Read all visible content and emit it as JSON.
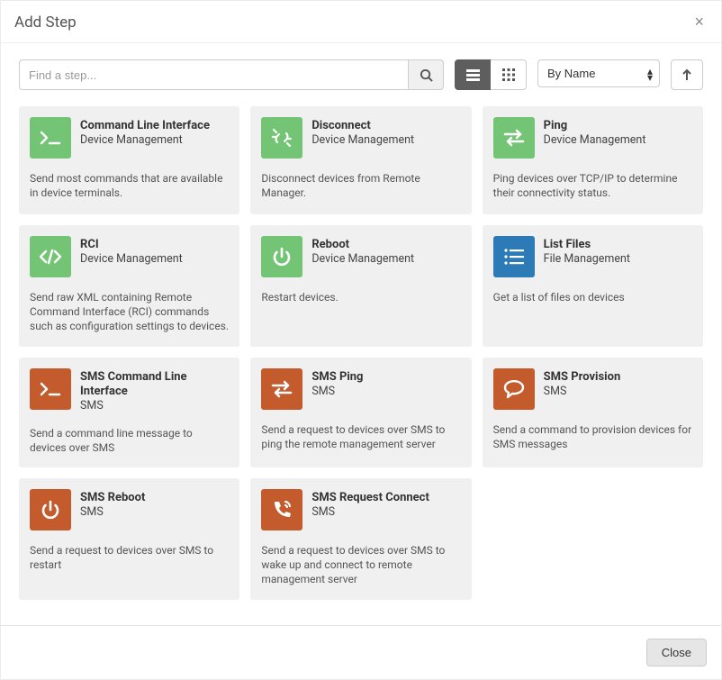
{
  "dialog": {
    "title": "Add Step",
    "close_label": "Close"
  },
  "search": {
    "placeholder": "Find a step..."
  },
  "sort": {
    "selected": "By Name"
  },
  "cards": [
    {
      "icon": "terminal-icon",
      "color": "green",
      "title": "Command Line Interface",
      "subtitle": "Device Management",
      "desc": "Send most commands that are available in device terminals."
    },
    {
      "icon": "disconnect-icon",
      "color": "green",
      "title": "Disconnect",
      "subtitle": "Device Management",
      "desc": "Disconnect devices from Remote Manager."
    },
    {
      "icon": "swap-icon",
      "color": "green",
      "title": "Ping",
      "subtitle": "Device Management",
      "desc": "Ping devices over TCP/IP to determine their connectivity status."
    },
    {
      "icon": "code-icon",
      "color": "green",
      "title": "RCI",
      "subtitle": "Device Management",
      "desc": "Send raw XML containing Remote Command Interface (RCI) commands such as configuration settings to devices."
    },
    {
      "icon": "power-icon",
      "color": "green",
      "title": "Reboot",
      "subtitle": "Device Management",
      "desc": "Restart devices."
    },
    {
      "icon": "list-icon",
      "color": "blue",
      "title": "List Files",
      "subtitle": "File Management",
      "desc": "Get a list of files on devices"
    },
    {
      "icon": "terminal-icon",
      "color": "orange",
      "title": "SMS Command Line Interface",
      "subtitle": "SMS",
      "desc": "Send a command line message to devices over SMS"
    },
    {
      "icon": "swap-icon",
      "color": "orange",
      "title": "SMS Ping",
      "subtitle": "SMS",
      "desc": "Send a request to devices over SMS to ping the remote management server"
    },
    {
      "icon": "chat-icon",
      "color": "orange",
      "title": "SMS Provision",
      "subtitle": "SMS",
      "desc": "Send a command to provision devices for SMS messages"
    },
    {
      "icon": "power-icon",
      "color": "orange",
      "title": "SMS Reboot",
      "subtitle": "SMS",
      "desc": "Send a request to devices over SMS to restart"
    },
    {
      "icon": "phone-wave-icon",
      "color": "orange",
      "title": "SMS Request Connect",
      "subtitle": "SMS",
      "desc": "Send a request to devices over SMS to wake up and connect to remote management server"
    }
  ]
}
